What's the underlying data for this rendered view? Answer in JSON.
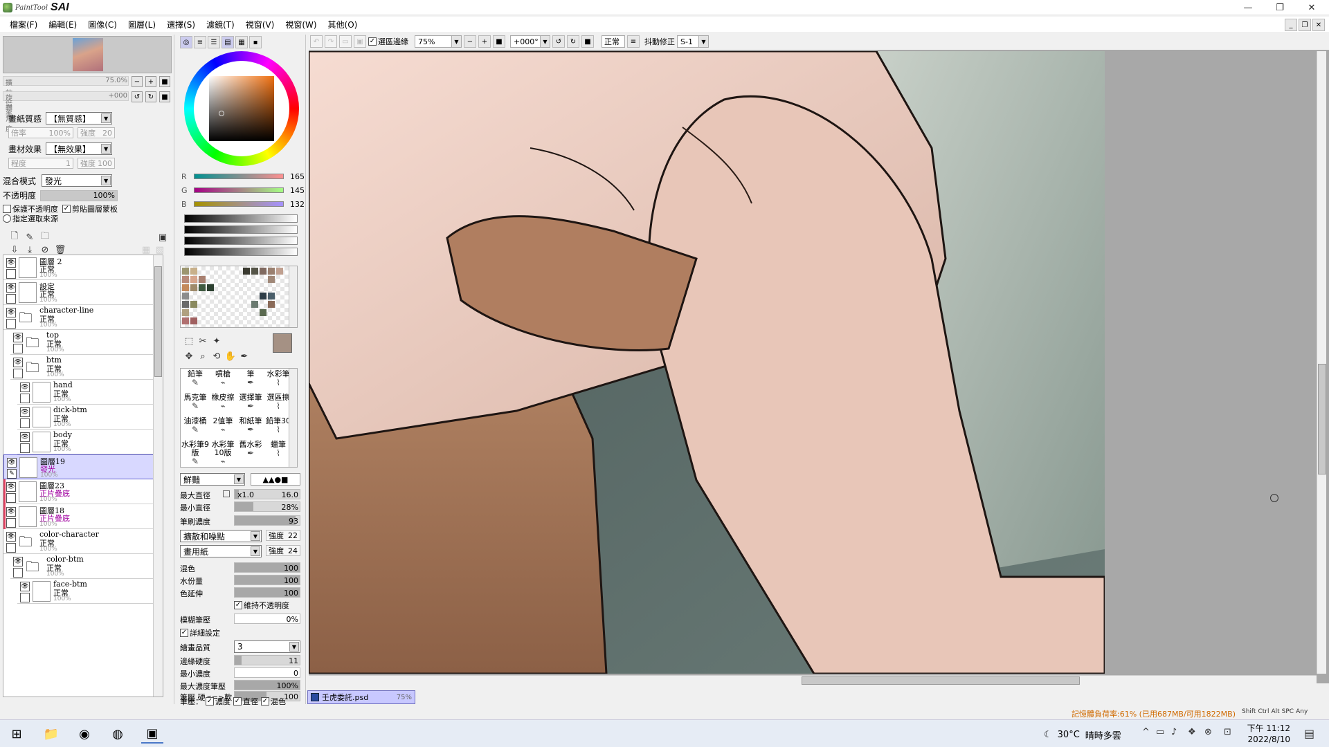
{
  "app": {
    "logo_small": "PaintTool",
    "logo_big": "SAI",
    "window_buttons": [
      "—",
      "❐",
      "✕"
    ]
  },
  "menu": [
    "檔案(F)",
    "編輯(E)",
    "圖像(C)",
    "圖層(L)",
    "選擇(S)",
    "濾鏡(T)",
    "視窗(V)",
    "視窗(W)",
    "其他(O)"
  ],
  "toolbar": {
    "selection_edge_label": "選區邊緣",
    "zoom": "75%",
    "rotation": "+000°",
    "normal_btn": "正常",
    "stabilizer_label": "抖動修正",
    "stabilizer_value": "S-1"
  },
  "navigator": {
    "zoom_label": "擴放倍率",
    "zoom_value": "75.0%",
    "angle_label": "旋轉角度",
    "angle_value": "+000"
  },
  "layer_props": {
    "texture_label": "畫紙質感",
    "texture_value": "【無質感】",
    "scale_label": "倍率",
    "scale_value": "100%",
    "strength_label": "強度",
    "strength_value": "20",
    "effect_label": "畫材效果",
    "effect_value": "【無效果】",
    "degree_label": "程度",
    "degree_value": "1",
    "effect_strength_label": "強度",
    "effect_strength_value": "100",
    "blend_label": "混合模式",
    "blend_value": "發光",
    "opacity_label": "不透明度",
    "opacity_value": "100%",
    "preserve_opacity": "保護不透明度",
    "clip_group": "剪貼圖層蒙板",
    "selection_source": "指定選取來源"
  },
  "layers": [
    {
      "name": "圖層 2",
      "mode": "正常",
      "opacity": "100%",
      "indent": 0,
      "type": "layer"
    },
    {
      "name": "設定",
      "mode": "正常",
      "opacity": "100%",
      "indent": 0,
      "type": "layer"
    },
    {
      "name": "character-line",
      "mode": "正常",
      "opacity": "100%",
      "indent": 0,
      "type": "folder"
    },
    {
      "name": "top",
      "mode": "正常",
      "opacity": "100%",
      "indent": 1,
      "type": "folder"
    },
    {
      "name": "btm",
      "mode": "正常",
      "opacity": "100%",
      "indent": 1,
      "type": "folder"
    },
    {
      "name": "hand",
      "mode": "正常",
      "opacity": "100%",
      "indent": 2,
      "type": "layer"
    },
    {
      "name": "dick-btm",
      "mode": "正常",
      "opacity": "100%",
      "indent": 2,
      "type": "layer"
    },
    {
      "name": "body",
      "mode": "正常",
      "opacity": "100%",
      "indent": 2,
      "type": "layer"
    },
    {
      "name": "圖層19",
      "mode": "發光",
      "opacity": "100%",
      "indent": 0,
      "type": "layer",
      "selected": true
    },
    {
      "name": "圖層23",
      "mode": "正片疊底",
      "opacity": "100%",
      "indent": 0,
      "type": "layer",
      "clip": true
    },
    {
      "name": "圖層18",
      "mode": "正片疊底",
      "opacity": "100%",
      "indent": 0,
      "type": "layer",
      "clip": true
    },
    {
      "name": "color-character",
      "mode": "正常",
      "opacity": "100%",
      "indent": 0,
      "type": "folder"
    },
    {
      "name": "color-btm",
      "mode": "正常",
      "opacity": "100%",
      "indent": 1,
      "type": "folder"
    },
    {
      "name": "face-btm",
      "mode": "正常",
      "opacity": "100%",
      "indent": 2,
      "type": "layer"
    }
  ],
  "color": {
    "r_label": "R",
    "r": "165",
    "g_label": "G",
    "g": "145",
    "b_label": "B",
    "b": "132",
    "current_hex": "#a59184"
  },
  "brushes": [
    [
      "鉛筆",
      "噴槍",
      "筆",
      "水彩筆"
    ],
    [
      "馬克筆",
      "橡皮擦",
      "選擇筆",
      "選區擦"
    ],
    [
      "油漆桶",
      "2值筆",
      "和紙筆",
      "鉛筆30"
    ],
    [
      "水彩筆9版",
      "水彩筆10版",
      "舊水彩",
      "蠟筆"
    ]
  ],
  "brush_settings": {
    "shape_value": "鮮豔",
    "max_size_label": "最大直徑",
    "max_size_mult": "x1.0",
    "max_size_value": "16.0",
    "min_size_label": "最小直徑",
    "min_size_value": "28%",
    "density_label": "筆刷濃度",
    "density_value": "93",
    "diffuse_value": "擴散和噪點",
    "diffuse_strength_label": "強度",
    "diffuse_strength_value": "22",
    "paper_value": "畫用紙",
    "paper_strength_label": "強度",
    "paper_strength_value": "24",
    "blend_label": "混色",
    "blend_value": "100",
    "water_label": "水份量",
    "water_value": "100",
    "extend_label": "色延伸",
    "extend_value": "100",
    "keep_opacity": "維持不透明度",
    "blur_label": "模糊筆壓",
    "blur_value": "0%",
    "detail_label": "詳細設定",
    "quality_label": "繪畫品質",
    "quality_value": "3",
    "edge_label": "邊緣硬度",
    "edge_value": "11",
    "min_density_label": "最小濃度",
    "min_density_value": "0",
    "max_pressure_label": "最大濃度筆壓",
    "max_pressure_value": "100%",
    "hardsoft_label": "筆壓 硬<=>軟",
    "hardsoft_value": "100",
    "pressure_label": "筆壓：",
    "pressure_density": "濃度",
    "pressure_size": "直徑",
    "pressure_blend": "混色"
  },
  "document": {
    "tab_name": "壬虎委託.psd",
    "tab_zoom": "75%"
  },
  "status": {
    "memory": "記憶體負荷率:61% (已用687MB/可用1822MB)",
    "keys": [
      "Shift",
      "Ctrl",
      "Alt",
      "SPC",
      "Any"
    ]
  },
  "taskbar": {
    "temperature": "30°C",
    "weather": "晴時多雲",
    "time": "下午 11:12",
    "date": "2022/8/10"
  }
}
